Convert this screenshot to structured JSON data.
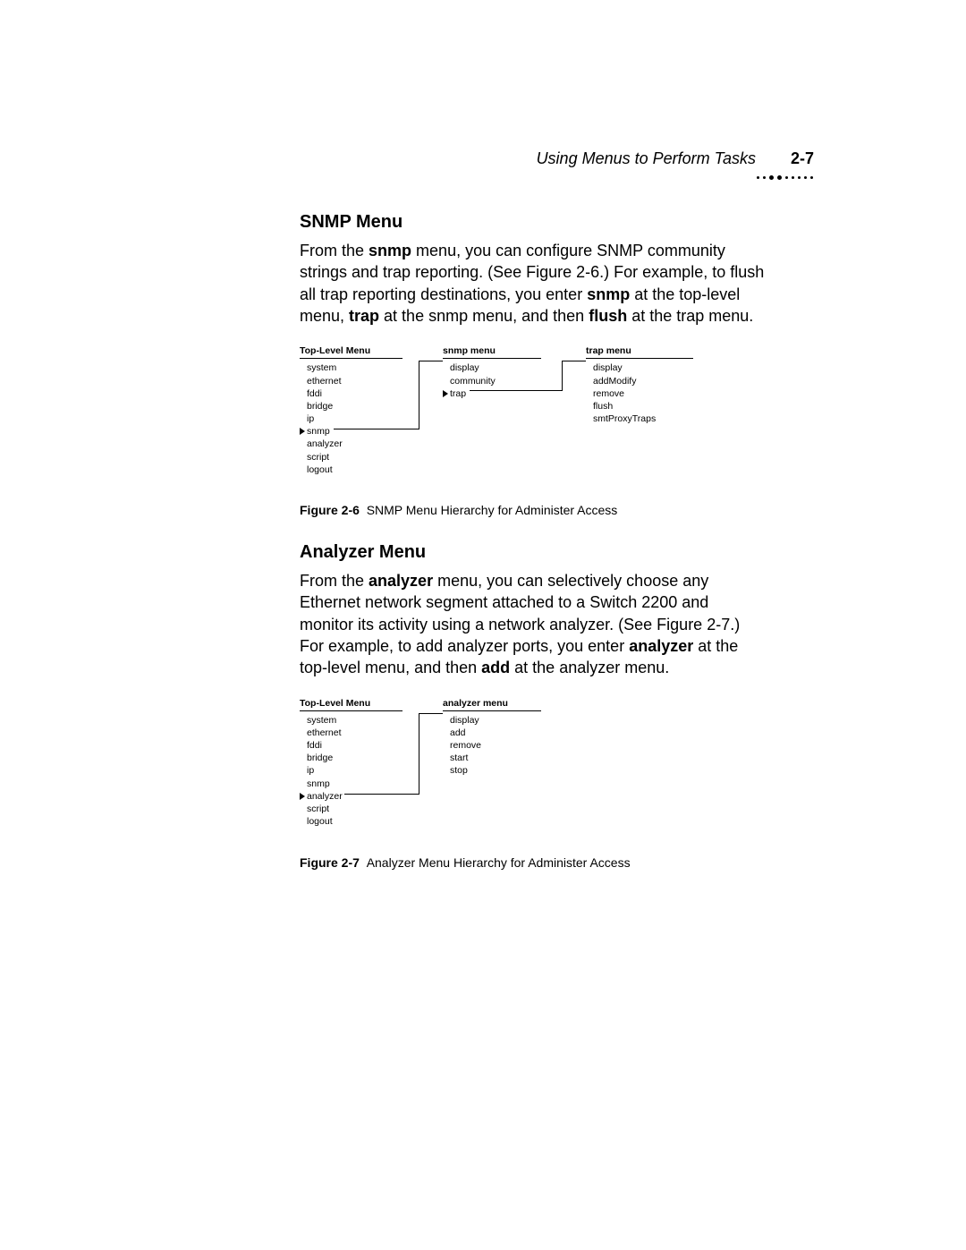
{
  "header": {
    "title": "Using Menus to Perform Tasks",
    "page": "2-7"
  },
  "snmp": {
    "heading": "SNMP Menu",
    "para_parts": [
      "From the ",
      "snmp",
      " menu, you can configure SNMP community strings and trap reporting. (See Figure 2-6.) For example, to flush all trap reporting destinations, you enter ",
      "snmp",
      " at the top-level menu, ",
      "trap",
      " at the snmp menu, and then ",
      "flush",
      " at the trap menu."
    ],
    "fig": {
      "label": "Figure 2-6",
      "caption": "SNMP Menu Hierarchy for Administer Access",
      "cols": [
        {
          "title": "Top-Level Menu",
          "items": [
            "system",
            "ethernet",
            "fddi",
            "bridge",
            "ip",
            "snmp",
            "analyzer",
            "script",
            "logout"
          ],
          "sel": 5
        },
        {
          "title": "snmp menu",
          "items": [
            "display",
            "community",
            "trap"
          ],
          "sel": 2
        },
        {
          "title": "trap menu",
          "items": [
            "display",
            "addModify",
            "remove",
            "flush",
            "smtProxyTraps"
          ],
          "sel": -1
        }
      ]
    }
  },
  "analyzer": {
    "heading": "Analyzer Menu",
    "para_parts": [
      "From the ",
      "analyzer",
      " menu, you can selectively choose any Ethernet network segment attached to a Switch 2200 and monitor its activity using a network analyzer. (See Figure 2-7.) For example, to add analyzer ports, you enter ",
      "analyzer",
      " at the top-level menu, and then ",
      "add",
      " at the analyzer menu."
    ],
    "fig": {
      "label": "Figure 2-7",
      "caption": "Analyzer Menu Hierarchy for Administer Access",
      "cols": [
        {
          "title": "Top-Level Menu",
          "items": [
            "system",
            "ethernet",
            "fddi",
            "bridge",
            "ip",
            "snmp",
            "analyzer",
            "script",
            "logout"
          ],
          "sel": 6
        },
        {
          "title": "analyzer menu",
          "items": [
            "display",
            "add",
            "remove",
            "start",
            "stop"
          ],
          "sel": -1
        }
      ]
    }
  }
}
